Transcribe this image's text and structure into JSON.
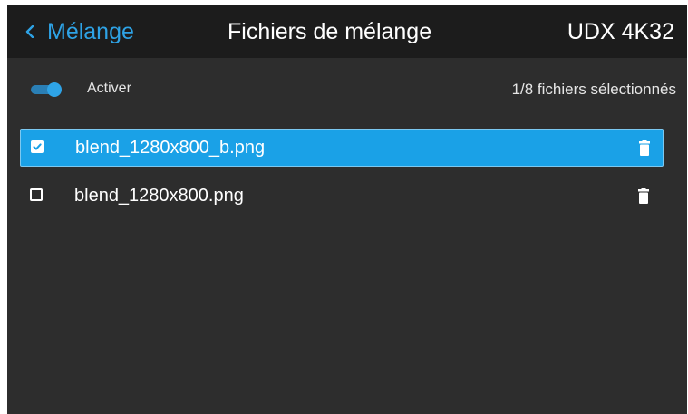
{
  "header": {
    "back_label": "Mélange",
    "title": "Fichiers de mélange",
    "device": "UDX 4K32"
  },
  "toggle": {
    "label": "Activer",
    "enabled": true
  },
  "selection_count": "1/8 fichiers sélectionnés",
  "files": [
    {
      "name": "blend_1280x800_b.png",
      "selected": true
    },
    {
      "name": "blend_1280x800.png",
      "selected": false
    }
  ],
  "colors": {
    "accent": "#2ea3e6",
    "selected_row": "#1aa1e7",
    "background": "#2d2d2d",
    "header": "#1c1c1c"
  },
  "icons": {
    "back": "chevron-left-icon",
    "delete": "trash-icon",
    "checked": "checkbox-checked-icon",
    "unchecked": "checkbox-unchecked-icon"
  }
}
